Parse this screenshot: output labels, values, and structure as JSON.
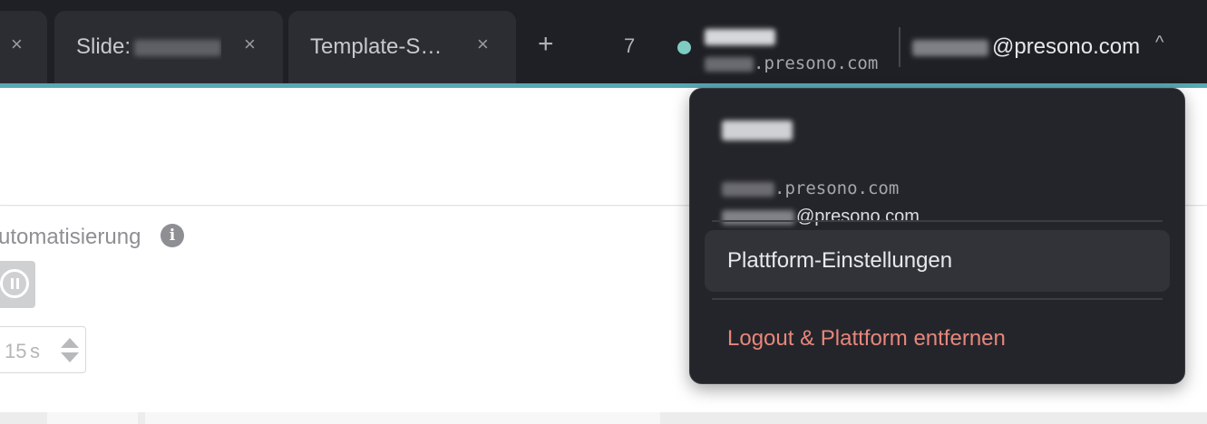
{
  "tabs": [
    {
      "label": "",
      "close": "×"
    },
    {
      "label": "Slide:",
      "close": "×"
    },
    {
      "label": "Template-S…",
      "close": "×"
    }
  ],
  "tab_add": "+",
  "tab_count": "7",
  "platform": {
    "host_suffix": ".presono.com"
  },
  "user": {
    "email_suffix": "@presono.com",
    "caret": "^"
  },
  "page": {
    "automation_label": "utomatisierung",
    "info_icon": "i",
    "duration_value": "15",
    "duration_unit": "s"
  },
  "dropdown": {
    "host_suffix": ".presono.com",
    "email_suffix": "@presono.com",
    "settings_label": "Plattform-Einstellungen",
    "logout_label": "Logout & Plattform entfernen"
  },
  "colors": {
    "topbar": "#1f2025",
    "accent": "#57a9b5",
    "status_online": "#7ecbc2",
    "logout": "#e8867a"
  },
  "icons": [
    "close-icon",
    "plus-icon",
    "status-dot-icon",
    "caret-up-icon",
    "info-icon",
    "pause-circle-icon",
    "stepper-icon"
  ]
}
